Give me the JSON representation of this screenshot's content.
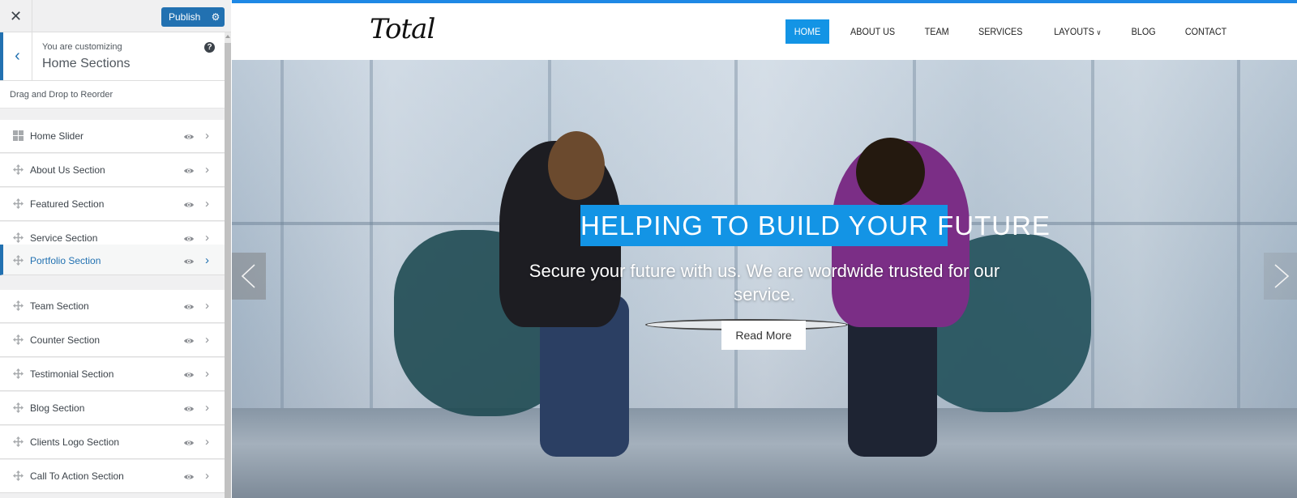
{
  "customizer": {
    "close_icon": "close-icon",
    "publish_label": "Publish",
    "settings_icon": "gear-icon",
    "back_icon": "chevron-left-icon",
    "context_label": "You are customizing",
    "section_title": "Home Sections",
    "help_icon": "question-mark-icon",
    "help_glyph": "?",
    "description": "Drag and Drop to Reorder",
    "items": [
      {
        "label": "Home Slider",
        "handle_icon": "grid-icon",
        "visible_icon": "eye-icon",
        "active": false
      },
      {
        "label": "About Us Section",
        "handle_icon": "move-icon",
        "visible_icon": "eye-icon",
        "active": false
      },
      {
        "label": "Featured Section",
        "handle_icon": "move-icon",
        "visible_icon": "eye-icon",
        "active": false
      },
      {
        "label": "Service Section",
        "handle_icon": "move-icon",
        "visible_icon": "eye-icon",
        "active": false
      },
      {
        "label": "Portfolio Section",
        "handle_icon": "move-icon",
        "visible_icon": "eye-icon",
        "active": true
      },
      {
        "label": "Team Section",
        "handle_icon": "move-icon",
        "visible_icon": "eye-icon",
        "active": false
      },
      {
        "label": "Counter Section",
        "handle_icon": "move-icon",
        "visible_icon": "eye-icon",
        "active": false
      },
      {
        "label": "Testimonial Section",
        "handle_icon": "move-icon",
        "visible_icon": "eye-icon",
        "active": false
      },
      {
        "label": "Blog Section",
        "handle_icon": "move-icon",
        "visible_icon": "eye-icon",
        "active": false
      },
      {
        "label": "Clients Logo Section",
        "handle_icon": "move-icon",
        "visible_icon": "eye-icon",
        "active": false
      },
      {
        "label": "Call To Action Section",
        "handle_icon": "move-icon",
        "visible_icon": "eye-icon",
        "active": false
      }
    ]
  },
  "site": {
    "logo": "Total",
    "nav": [
      {
        "label": "HOME",
        "active": true
      },
      {
        "label": "ABOUT US",
        "active": false
      },
      {
        "label": "TEAM",
        "active": false
      },
      {
        "label": "SERVICES",
        "active": false
      },
      {
        "label": "LAYOUTS",
        "active": false,
        "has_dropdown": true
      },
      {
        "label": "BLOG",
        "active": false
      },
      {
        "label": "CONTACT",
        "active": false
      }
    ],
    "hero": {
      "title": "HELPING TO BUILD YOUR FUTURE",
      "subtitle": "Secure your future with us. We are wordwide trusted for our service.",
      "button_label": "Read More",
      "prev_icon": "chevron-left-icon",
      "next_icon": "chevron-right-icon"
    }
  },
  "colors": {
    "wp_blue": "#2271b1",
    "site_accent": "#1394e5",
    "top_bar": "#1e88e5"
  }
}
